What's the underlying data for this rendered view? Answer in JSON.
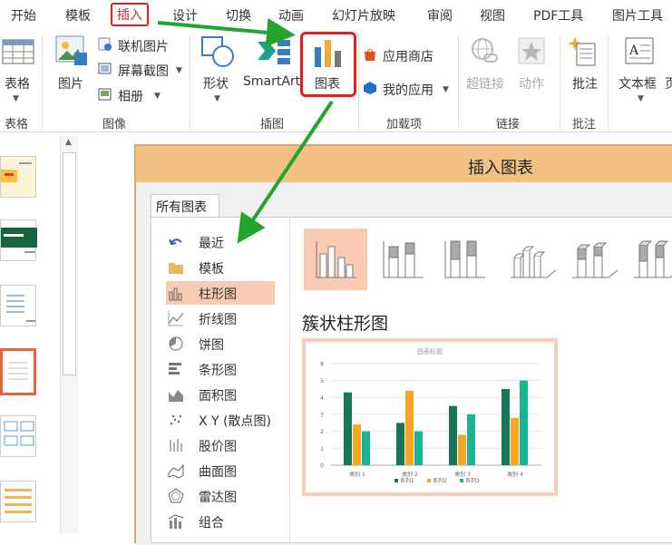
{
  "tabs": [
    "开始",
    "模板",
    "插入",
    "设计",
    "切换",
    "动画",
    "幻灯片放映",
    "审阅",
    "视图",
    "PDF工具",
    "图片工具"
  ],
  "ribbon": {
    "table": {
      "label": "表格",
      "group": "表格"
    },
    "image": {
      "picture": "图片",
      "online": "联机图片",
      "screenshot": "屏幕截图",
      "album": "相册",
      "group": "图像"
    },
    "illustration": {
      "shapes": "形状",
      "smartart": "SmartArt",
      "chart": "图表",
      "group": "插图"
    },
    "addins": {
      "store": "应用商店",
      "myapps": "我的应用",
      "group": "加载项"
    },
    "links": {
      "hyperlink": "超链接",
      "action": "动作",
      "group": "链接"
    },
    "comment": {
      "label": "批注",
      "group": "批注"
    },
    "textbox": {
      "label": "文本框",
      "extra": "页"
    }
  },
  "dialog": {
    "title": "插入图表",
    "tab": "所有图表",
    "categories": [
      "最近",
      "模板",
      "柱形图",
      "折线图",
      "饼图",
      "条形图",
      "面积图",
      "X Y (散点图)",
      "股价图",
      "曲面图",
      "雷达图",
      "组合"
    ],
    "selected_category": "柱形图",
    "selected_subtype_title": "簇状柱形图"
  },
  "colors": {
    "accent": "#f2bf85",
    "selection": "#f9cbb3",
    "highlight": "#e0201b",
    "arrow": "#22a52e"
  },
  "chart_data": {
    "type": "bar",
    "title": "图表标题",
    "categories": [
      "类别 1",
      "类别 2",
      "类别 3",
      "类别 4"
    ],
    "series": [
      {
        "name": "系列1",
        "values": [
          4.3,
          2.5,
          3.5,
          4.5
        ],
        "color": "#17765a"
      },
      {
        "name": "系列2",
        "values": [
          2.4,
          4.4,
          1.8,
          2.8
        ],
        "color": "#f5a623"
      },
      {
        "name": "系列3",
        "values": [
          2,
          2,
          3,
          5
        ],
        "color": "#1ab394"
      }
    ],
    "ylim": [
      0,
      6
    ],
    "yticks": [
      "0",
      "1",
      "2",
      "3",
      "4",
      "5",
      "6"
    ],
    "grid": true,
    "legend": "bottom"
  }
}
